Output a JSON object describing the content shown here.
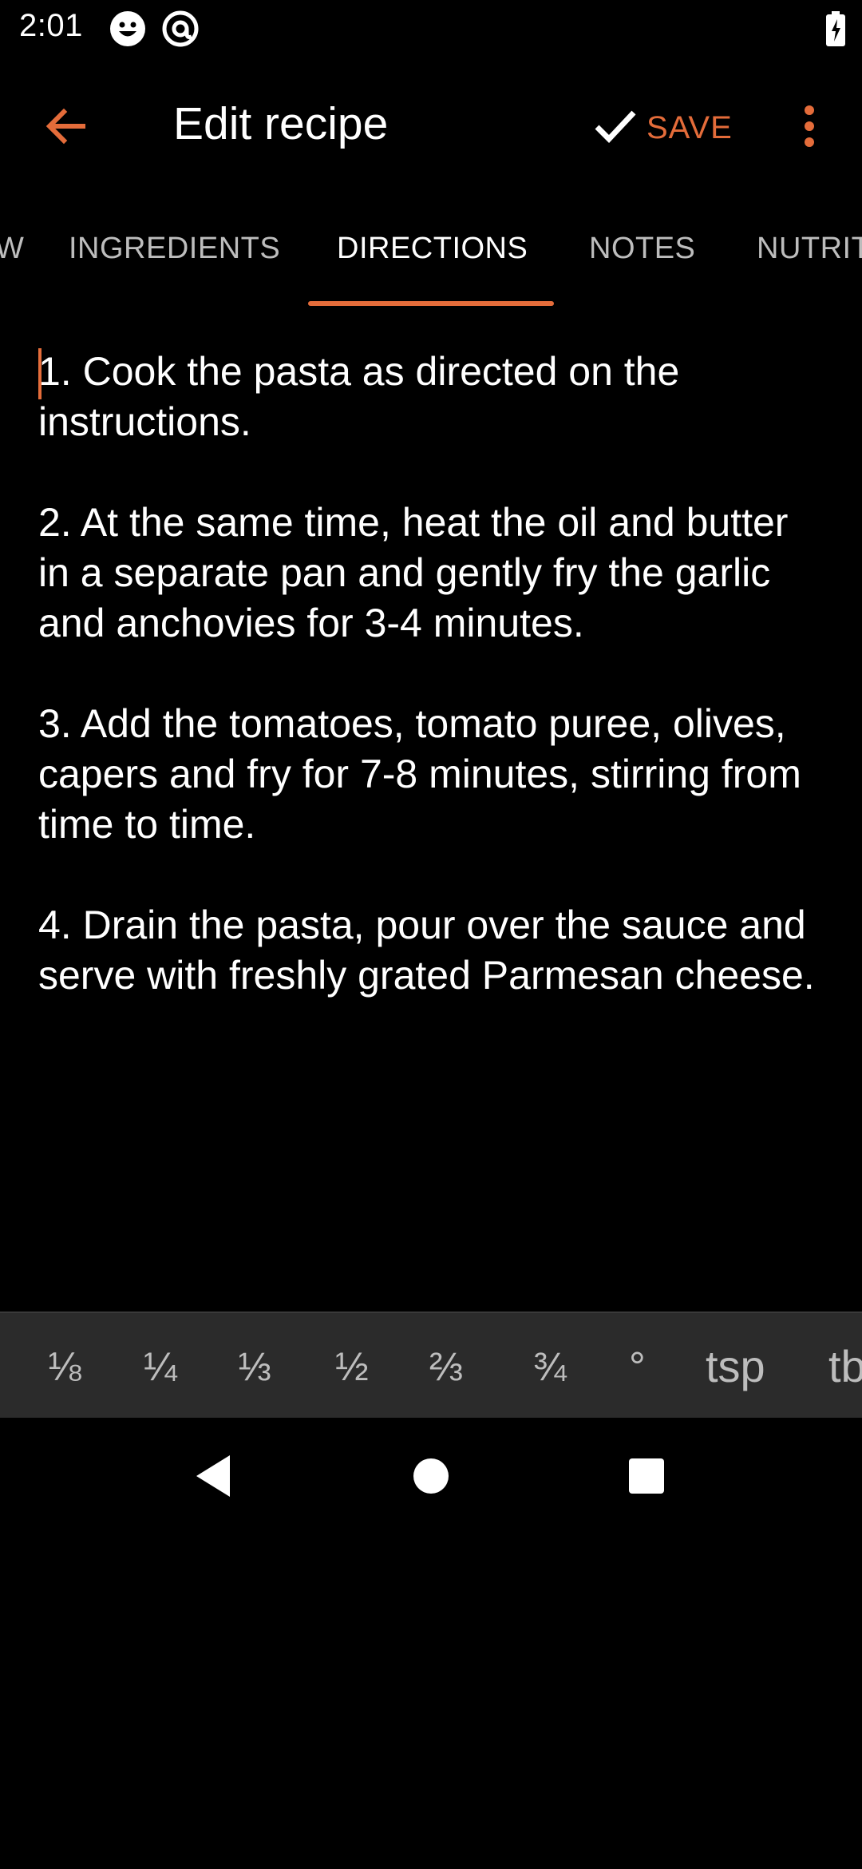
{
  "status_bar": {
    "time": "2:01",
    "icons": [
      "emoji-face-icon",
      "at-circle-icon"
    ],
    "battery": "battery-charging-icon"
  },
  "app_bar": {
    "title": "Edit recipe",
    "save_label": "SAVE",
    "accent": "#e46c3a"
  },
  "tabs": [
    {
      "label": "W",
      "active": false
    },
    {
      "label": "INGREDIENTS",
      "active": false
    },
    {
      "label": "DIRECTIONS",
      "active": true
    },
    {
      "label": "NOTES",
      "active": false
    },
    {
      "label": "NUTRIT",
      "active": false
    }
  ],
  "directions": [
    "1. Cook the pasta as directed on the instructions.",
    "2. At the same time, heat the oil and butter in a separate pan and gently fry the garlic and anchovies for 3-4 minutes.",
    "3. Add the tomatoes, tomato puree, olives, capers and fry for 7-8 minutes, stirring from time to time.",
    "4. Drain the pasta, pour over the sauce and serve with freshly grated Parmesan cheese."
  ],
  "fraction_bar": {
    "items": [
      "⅛",
      "¼",
      "⅓",
      "½",
      "⅔",
      "¾",
      "°",
      "tsp",
      "tb"
    ]
  },
  "nav": {
    "back": "back-triangle-icon",
    "home": "home-circle-icon",
    "recents": "recents-square-icon"
  }
}
